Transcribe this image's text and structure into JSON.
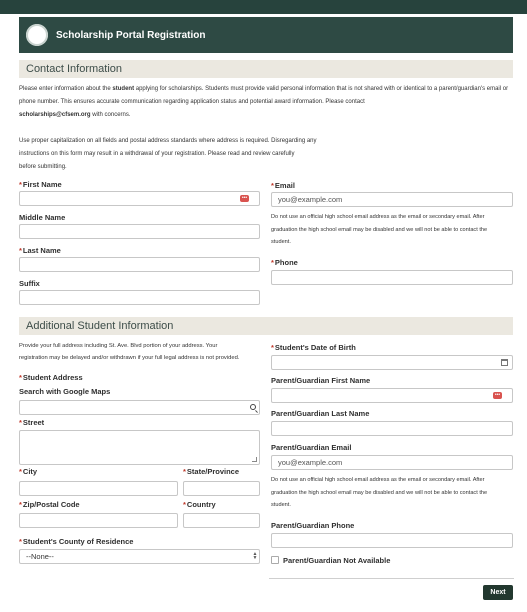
{
  "banner": {
    "title": "Scholarship Portal Registration"
  },
  "contact": {
    "header": "Contact Information",
    "intro_1": "Please enter information about the ",
    "intro_bold": "student",
    "intro_2": " applying for scholarships. Students must provide valid personal information that is not shared with or identical to a parent/guardian's email or",
    "intro_3": "phone number. This ensures accurate communication regarding application status and potential award information. Please contact",
    "intro_email": "scholarships@cfsem.org",
    "intro_4": " with concerns.",
    "cap_1": "Use proper capitalization on all fields and postal address standards where address is required. Disregarding any",
    "cap_2": "instructions on this form may result in a withdrawal of your registration. Please read and review carefully",
    "cap_3": "before submitting.",
    "first_name_label": "First Name",
    "middle_name_label": "Middle Name",
    "last_name_label": "Last Name",
    "suffix_label": "Suffix",
    "email_label": "Email",
    "email_placeholder": "you@example.com",
    "email_note_1": "Do not use an official high school email address as the email or secondary email. After",
    "email_note_2": "graduation the high school email may be disabled and we will not be able to contact the",
    "email_note_3": "student.",
    "phone_label": "Phone",
    "autofill_badge": "•••"
  },
  "student": {
    "header": "Additional Student Information",
    "addr_note_1": "Provide your full address including St. Ave. Blvd portion of your address. Your",
    "addr_note_2": "registration may be delayed and/or withdrawn if your full legal address is not provided.",
    "address_label": "Student Address",
    "search_maps_label": "Search with Google Maps",
    "street_label": "Street",
    "city_label": "City",
    "state_label": "State/Province",
    "zip_label": "Zip/Postal Code",
    "country_label": "Country",
    "county_label": "Student's County of Residence",
    "county_value": "--None--",
    "dob_label": "Student's Date of Birth",
    "pg_first_label": "Parent/Guardian First Name",
    "pg_last_label": "Parent/Guardian Last Name",
    "pg_email_label": "Parent/Guardian Email",
    "pg_email_placeholder": "you@example.com",
    "pg_note_1": "Do not use an official high school email address as the email or secondary email. After",
    "pg_note_2": "graduation the high school email may be disabled and we will not be able to contact the",
    "pg_note_3": "student.",
    "pg_phone_label": "Parent/Guardian Phone",
    "pg_not_available_label": "Parent/Guardian Not Available"
  },
  "footer": {
    "next_label": "Next"
  },
  "required_mark": "*",
  "colors": {
    "banner": "#2e4a44",
    "section": "#ebe8e0",
    "required": "#c0392b",
    "button": "#22382f"
  }
}
